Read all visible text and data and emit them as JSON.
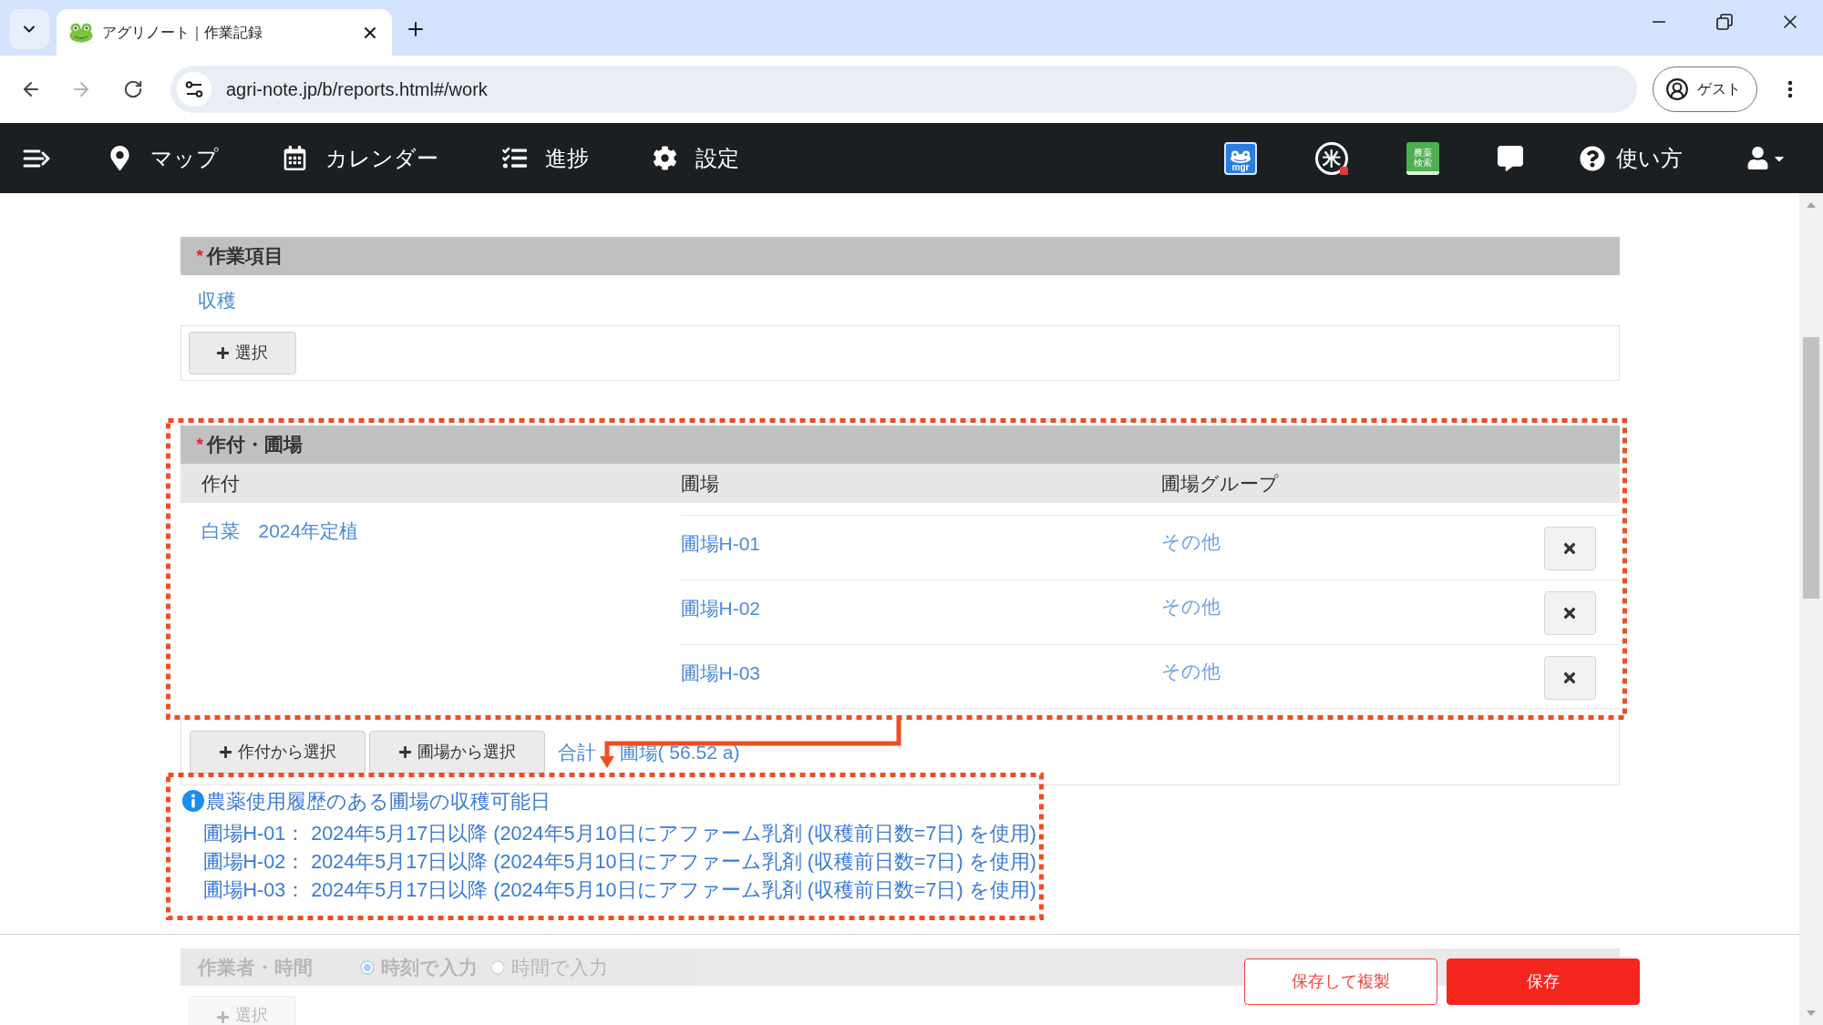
{
  "browser": {
    "tab": {
      "title": "アグリノート｜作業記録"
    },
    "address": "agri-note.jp/b/reports.html#/work",
    "profile": "ゲスト"
  },
  "navbar": {
    "items": [
      {
        "label": "マップ"
      },
      {
        "label": "カレンダー"
      },
      {
        "label": "進捗"
      },
      {
        "label": "設定"
      }
    ],
    "apps": [
      {
        "kind": "manager",
        "label": "mgr"
      },
      {
        "kind": "rice",
        "label": "米"
      },
      {
        "kind": "book",
        "label": "農薬検索"
      }
    ],
    "help": "使い方"
  },
  "work_item": {
    "marker": "*",
    "title": "作業項目",
    "value": "収穫",
    "button": "選択"
  },
  "crop_fields": {
    "marker": "*",
    "title": "作付・圃場",
    "columns": [
      "作付",
      "圃場",
      "圃場グループ"
    ],
    "crop": "白菜　2024年定植",
    "rows": [
      {
        "field": "圃場H-01",
        "group": "その他"
      },
      {
        "field": "圃場H-02",
        "group": "その他"
      },
      {
        "field": "圃場H-03",
        "group": "その他"
      }
    ],
    "buttons": [
      "作付から選択",
      "圃場から選択"
    ],
    "total_label": "合計",
    "total_value": "圃場( 56.52 a)"
  },
  "harvest_notice": {
    "title": "農薬使用履歴のある圃場の収穫可能日",
    "lines": [
      "圃場H-01： 2024年5月17日以降 (2024年5月10日にアファーム乳剤 (収穫前日数=7日) を使用)",
      "圃場H-02： 2024年5月17日以降 (2024年5月10日にアファーム乳剤 (収穫前日数=7日) を使用)",
      "圃場H-03： 2024年5月17日以降 (2024年5月10日にアファーム乳剤 (収穫前日数=7日) を使用)"
    ]
  },
  "worker_time": {
    "title": "作業者・時間",
    "options": [
      {
        "label": "時刻で入力",
        "selected": true
      },
      {
        "label": "時間で入力",
        "selected": false
      }
    ],
    "button": "選択"
  },
  "footer": {
    "buttons": [
      {
        "kind": "secondary",
        "label": "保存して複製"
      },
      {
        "kind": "primary",
        "label": "保存"
      }
    ]
  }
}
